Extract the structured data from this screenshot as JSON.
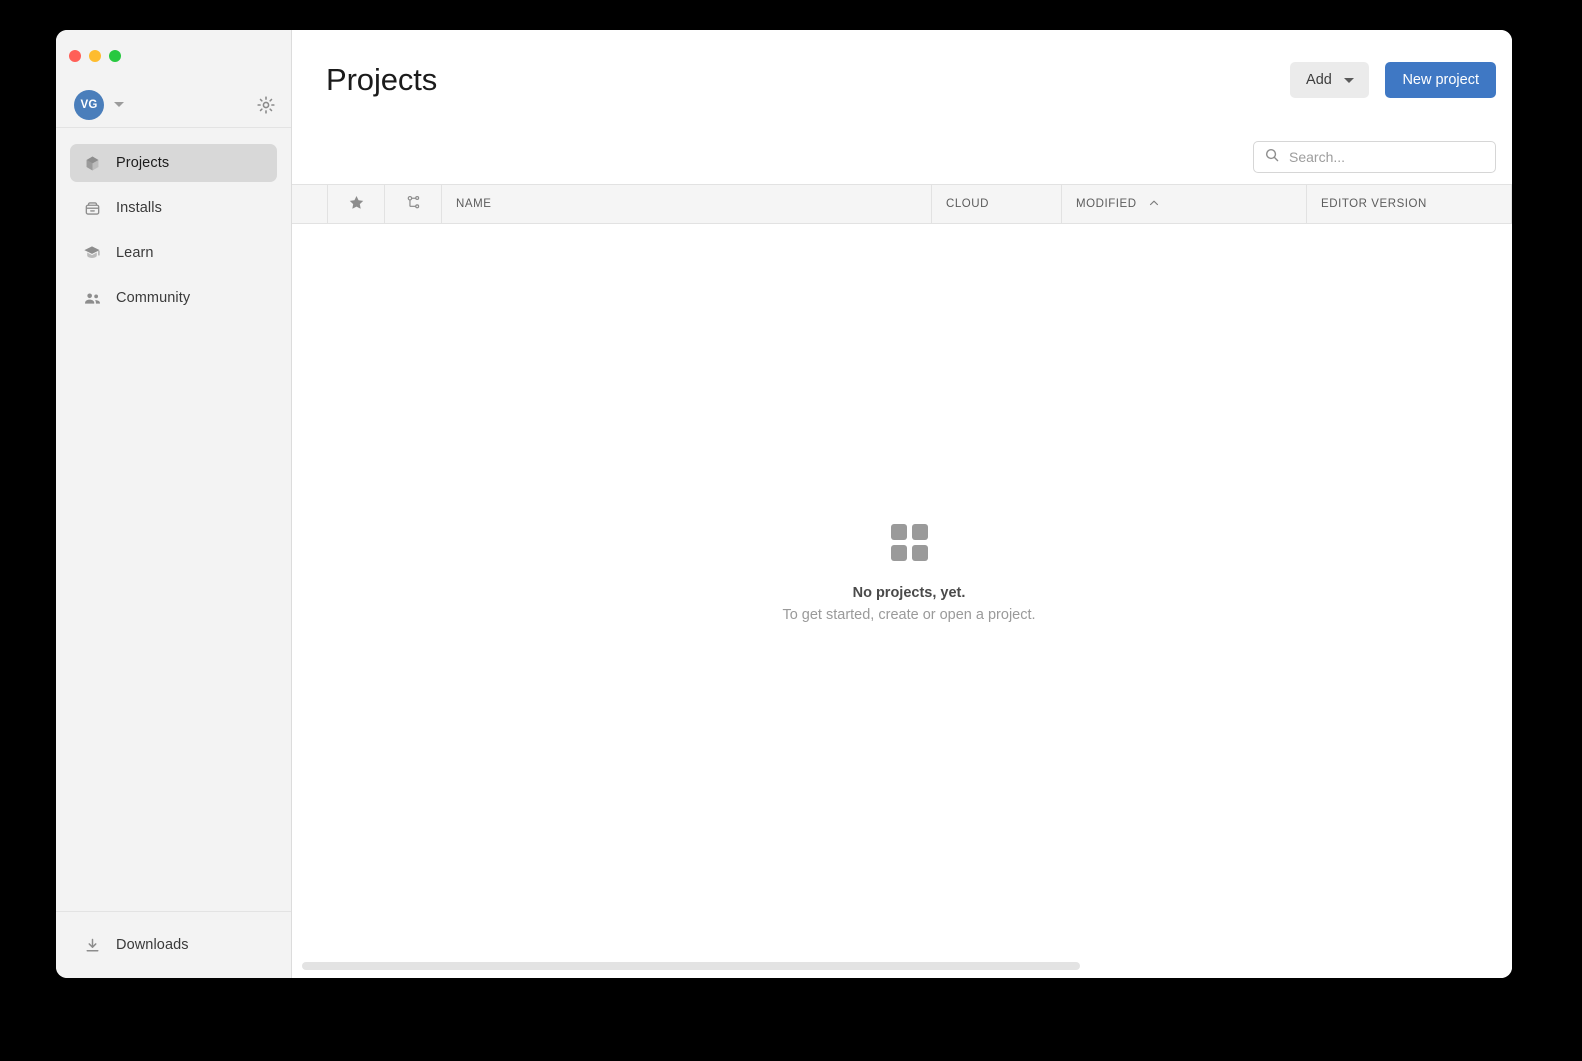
{
  "window": {
    "traffic_lights": [
      {
        "name": "close",
        "color": "#ff5f57"
      },
      {
        "name": "minimize",
        "color": "#febc2e"
      },
      {
        "name": "maximize",
        "color": "#28c840"
      }
    ]
  },
  "sidebar": {
    "account": {
      "initials": "VG",
      "avatar_color": "#4a7ebb",
      "caret_icon": "chevron-down-icon",
      "settings_icon": "gear-icon"
    },
    "items": [
      {
        "label": "Projects",
        "icon": "cube-icon",
        "selected": true
      },
      {
        "label": "Installs",
        "icon": "archive-icon",
        "selected": false
      },
      {
        "label": "Learn",
        "icon": "graduation-icon",
        "selected": false
      },
      {
        "label": "Community",
        "icon": "people-icon",
        "selected": false
      }
    ],
    "footer": {
      "label": "Downloads",
      "icon": "download-icon"
    }
  },
  "header": {
    "title": "Projects",
    "add_label": "Add",
    "add_caret_icon": "caret-down-icon",
    "new_project_label": "New project",
    "new_project_color": "#3f78c4"
  },
  "search": {
    "placeholder": "Search...",
    "value": "",
    "icon": "search-icon"
  },
  "table": {
    "columns": [
      {
        "key": "blank",
        "label": "",
        "type": "blank"
      },
      {
        "key": "star",
        "label": "",
        "type": "icon",
        "icon": "star-icon"
      },
      {
        "key": "vcs",
        "label": "",
        "type": "icon",
        "icon": "version-control-icon"
      },
      {
        "key": "name",
        "label": "NAME",
        "type": "text"
      },
      {
        "key": "cloud",
        "label": "CLOUD",
        "type": "text"
      },
      {
        "key": "mod",
        "label": "MODIFIED",
        "type": "text",
        "sort": "asc",
        "sort_icon": "chevron-up-icon"
      },
      {
        "key": "editor",
        "label": "EDITOR VERSION",
        "type": "text"
      },
      {
        "key": "last",
        "label": "",
        "type": "blank"
      }
    ],
    "rows": []
  },
  "empty_state": {
    "icon": "grid-4-squares-icon",
    "title": "No projects, yet.",
    "subtitle": "To get started, create or open a project."
  },
  "scrollbar": {
    "orientation": "horizontal",
    "name": "horizontal-scrollbar"
  }
}
